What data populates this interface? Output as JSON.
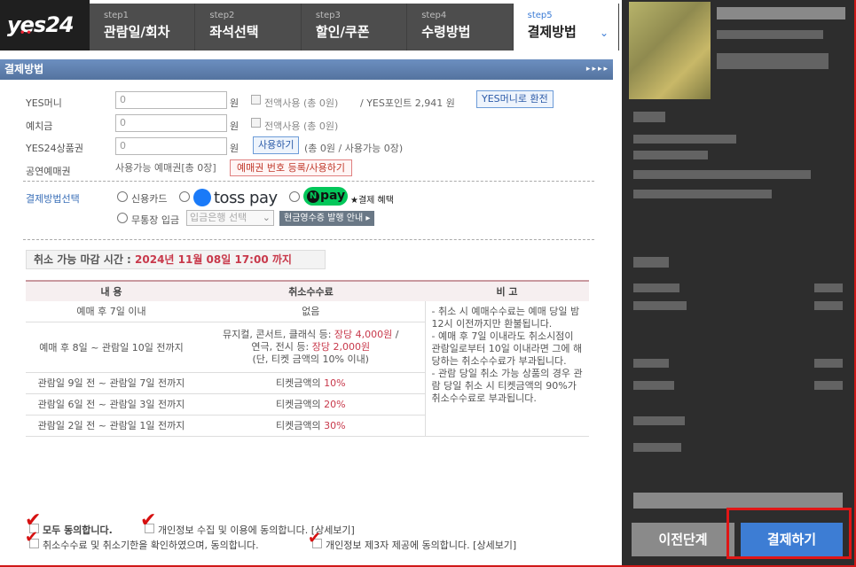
{
  "logo": {
    "text": "yes24"
  },
  "steps": [
    {
      "num": "step1",
      "label": "관람일/회차"
    },
    {
      "num": "step2",
      "label": "좌석선택"
    },
    {
      "num": "step3",
      "label": "할인/쿠폰"
    },
    {
      "num": "step4",
      "label": "수령방법"
    },
    {
      "num": "step5",
      "label": "결제방법"
    }
  ],
  "section_title": "결제방법",
  "section_arrows": "▸▸▸▸",
  "payment": {
    "yes_money": {
      "label": "YES머니",
      "value": "0",
      "unit": "원",
      "use_all": "전액사용 (총 0원)",
      "points": "/ YES포인트 2,941 원",
      "convert_btn": "YES머니로 환전"
    },
    "deposit": {
      "label": "예치금",
      "value": "0",
      "unit": "원",
      "use_all": "전액사용 (총 0원)"
    },
    "giftcard": {
      "label": "YES24상품권",
      "value": "0",
      "unit": "원",
      "use_btn": "사용하기",
      "summary": "(총 0원 / 사용가능 0장)"
    },
    "ticket_voucher": {
      "label": "공연예매권",
      "text": "사용가능 예매권[총 0장]",
      "register_btn": "예매권 번호 등록/사용하기"
    }
  },
  "method": {
    "label": "결제방법선택",
    "credit_card": "신용카드",
    "tosspay": "toss pay",
    "npay": "pay",
    "npay_benefit": "★결제 혜택",
    "bank_transfer": "무통장 입금",
    "bank_select": "입금은행 선택",
    "cash_receipt_btn": "현금영수증 발행 안내 ▸"
  },
  "deadline": {
    "prefix": "취소 가능 마감 시간 : ",
    "value": "2024년 11월 08일 17:00 까지"
  },
  "fee_table": {
    "headers": [
      "내 용",
      "취소수수료",
      "비 고"
    ],
    "rows": [
      {
        "content": "예매 후 7일 이내",
        "fee": "없음"
      },
      {
        "content": "예매 후 8일 ~ 관람일 10일 전까지",
        "fee_line1_a": "뮤지컬, 콘서트, 클래식 등: ",
        "fee_line1_b": "장당 4,000원",
        "fee_line1_c": " /",
        "fee_line2_a": "연극, 전시 등: ",
        "fee_line2_b": "장당 2,000원",
        "fee_line3": "(단, 티켓 금액의 10% 이내)"
      },
      {
        "content": "관람일 9일 전 ~ 관람일 7일 전까지",
        "fee_a": "티켓금액의 ",
        "fee_b": "10%"
      },
      {
        "content": "관람일 6일 전 ~ 관람일 3일 전까지",
        "fee_a": "티켓금액의 ",
        "fee_b": "20%"
      },
      {
        "content": "관람일 2일 전 ~ 관람일 1일 전까지",
        "fee_a": "티켓금액의 ",
        "fee_b": "30%"
      }
    ],
    "notes": [
      "- 취소 시 예매수수료는 예매 당일 밤 12시 이전까지만 환불됩니다.",
      "- 예매 후 7일 이내라도 취소시점이 관람일로부터 10일 이내라면 그에 해당하는 취소수수료가 부과됩니다.",
      "- 관람 당일 취소 가능 상품의 경우 관람 당일 취소 시 티켓금액의 90%가 취소수수료로 부과됩니다."
    ]
  },
  "consent": {
    "all": "모두 동의합니다.",
    "privacy": "개인정보 수집 및 이용에 동의합니다. [상세보기]",
    "cancel_fee": "취소수수료 및 취소기한을 확인하였으며, 동의합니다.",
    "third_party": "개인정보 제3자 제공에 동의합니다. [상세보기]"
  },
  "buttons": {
    "prev": "이전단계",
    "pay": "결제하기"
  },
  "colors": {
    "accent": "#3d7dd4",
    "highlight": "#e01616",
    "fee_red": "#c8394b",
    "step_bg": "#4d4d4d"
  }
}
